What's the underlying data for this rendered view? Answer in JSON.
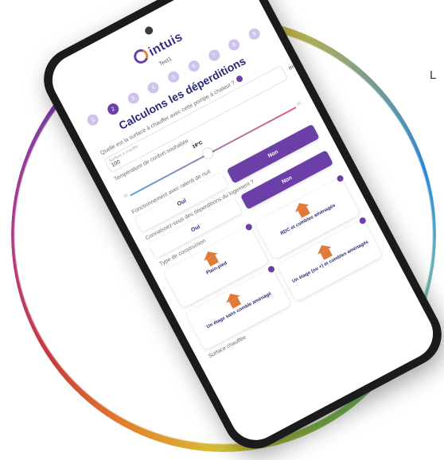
{
  "corner_letter": "L",
  "app": {
    "logo": "intuis",
    "project": "Test1"
  },
  "steps": [
    "1",
    "2",
    "3",
    "4",
    "5",
    "6",
    "7",
    "8",
    "9"
  ],
  "title": "Calculons les déperditions",
  "surface": {
    "question": "Quelle est la surface à chauffer avec cette pompe à chaleur ?",
    "field_label": "Surface à chauffer",
    "value": "100",
    "unit": "m²"
  },
  "temperature": {
    "label": "Température de confort souhaitée",
    "value": "19°C",
    "min": "15",
    "max": "22"
  },
  "ralenti": {
    "label": "Fonctionnement avec ralenti de nuit",
    "options": [
      "Oui",
      "Non"
    ],
    "selected": "Non"
  },
  "deperditions": {
    "label": "Connaissez-vous des déperditions du logement ?",
    "options": [
      "Oui",
      "Non"
    ],
    "selected": "Non"
  },
  "construction": {
    "label": "Type de construction",
    "cards": [
      "Plain-pied",
      "RDC et combles aménagés",
      "Un étage sans comble aménagé",
      "Un étage (ou +) et combles aménagés"
    ]
  },
  "tail_label": "Surface chauffée"
}
